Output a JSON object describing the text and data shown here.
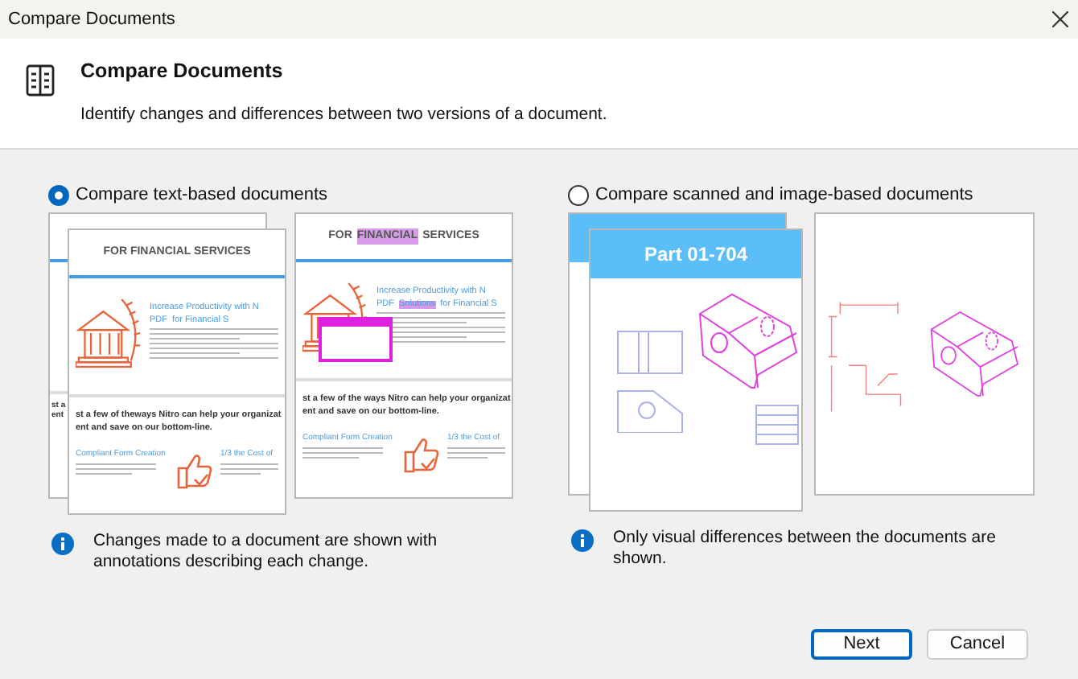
{
  "window": {
    "title": "Compare Documents"
  },
  "header": {
    "title": "Compare Documents",
    "description": "Identify changes and differences between two versions of a document."
  },
  "options": [
    {
      "kind": "text",
      "label": "Compare text-based documents",
      "selected": true,
      "info": "Changes made to a document are shown with annotations describing each change.",
      "back_page": {
        "fragment_1": "st a",
        "fragment_2": "ent"
      },
      "original_page": {
        "heading": "FOR FINANCIAL SERVICES",
        "subheading_1": "Increase Productivity with N",
        "subheading_2": "PDF",
        "subheading_3": "for Financial S",
        "tagline_1": "st a few of theways Nitro can help your organizat",
        "tagline_2": "ent and save on our bottom-line.",
        "feature_1": "Compliant Form Creation",
        "feature_2": "1/3 the Cost of"
      },
      "revised_page": {
        "heading_before": "FOR",
        "heading_highlight": "FINANCIAL",
        "heading_after": "SERVICES",
        "subheading_1": "Increase Productivity with N",
        "subheading_2": "PDF",
        "subheading_highlight": "Solutions",
        "subheading_3": "for Financial S",
        "tagline_1": "st a few of the ways Nitro can help your organizat",
        "tagline_2": "ent and save on our bottom-line.",
        "feature_1": "Compliant Form Creation",
        "feature_2": "1/3 the Cost of"
      }
    },
    {
      "kind": "image",
      "label": "Compare scanned and image-based documents",
      "selected": false,
      "info": "Only visual differences between the documents are shown.",
      "part_title": "Part 01-704"
    }
  ],
  "buttons": [
    {
      "label": "Next",
      "default": true
    },
    {
      "label": "Cancel",
      "default": false
    }
  ]
}
